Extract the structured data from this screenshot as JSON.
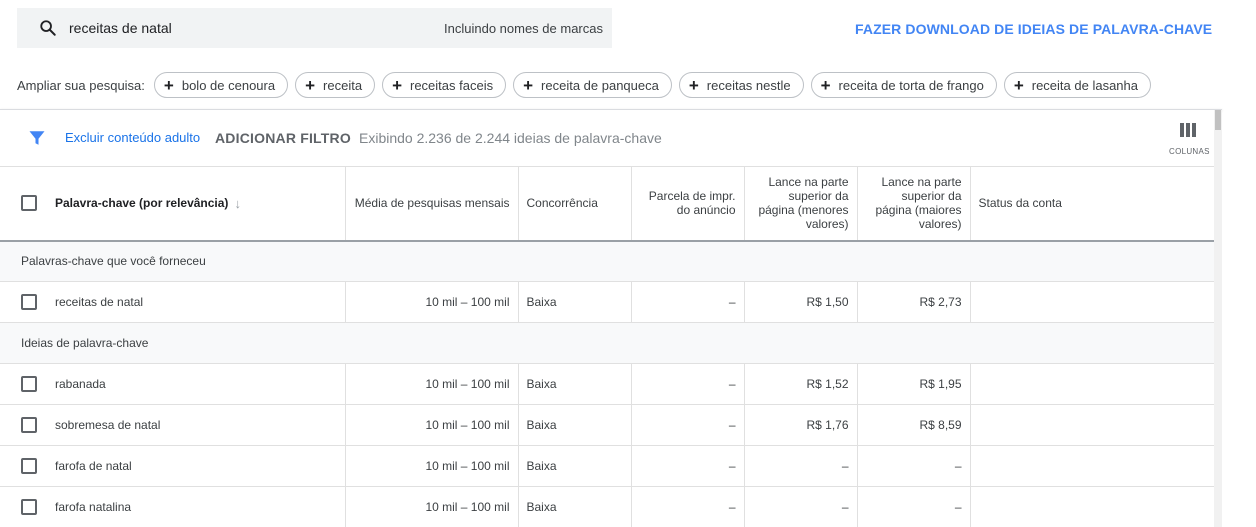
{
  "search": {
    "query": "receitas de natal",
    "brands_label": "Incluindo nomes de marcas",
    "download_label": "FAZER DOWNLOAD DE IDEIAS DE PALAVRA-CHAVE"
  },
  "broaden": {
    "label": "Ampliar sua pesquisa:",
    "chips": [
      "bolo de cenoura",
      "receita",
      "receitas faceis",
      "receita de panqueca",
      "receitas nestle",
      "receita de torta de frango",
      "receita de lasanha"
    ]
  },
  "filter_bar": {
    "adult_label": "Excluir conteúdo adulto",
    "add_filter_label": "ADICIONAR FILTRO",
    "showing_text": "Exibindo 2.236 de 2.244 ideias de palavra-chave",
    "columns_label": "COLUNAS"
  },
  "table": {
    "headers": {
      "keyword": "Palavra-chave (por relevância)",
      "searches": "Média de pesquisas mensais",
      "competition": "Concorrência",
      "impr_share": "Parcela de impr. do anúncio",
      "bid_low": "Lance na parte superior da página (menores valores)",
      "bid_high": "Lance na parte superior da página (maiores valores)",
      "status": "Status da conta"
    },
    "group_provided": "Palavras-chave que você forneceu",
    "group_ideas": "Ideias de palavra-chave",
    "provided_rows": [
      {
        "keyword": "receitas de natal",
        "searches": "10 mil – 100 mil",
        "competition": "Baixa",
        "impr_share": "–",
        "bid_low": "R$ 1,50",
        "bid_high": "R$ 2,73",
        "status": ""
      }
    ],
    "idea_rows": [
      {
        "keyword": "rabanada",
        "searches": "10 mil – 100 mil",
        "competition": "Baixa",
        "impr_share": "–",
        "bid_low": "R$ 1,52",
        "bid_high": "R$ 1,95",
        "status": ""
      },
      {
        "keyword": "sobremesa de natal",
        "searches": "10 mil – 100 mil",
        "competition": "Baixa",
        "impr_share": "–",
        "bid_low": "R$ 1,76",
        "bid_high": "R$ 8,59",
        "status": ""
      },
      {
        "keyword": "farofa de natal",
        "searches": "10 mil – 100 mil",
        "competition": "Baixa",
        "impr_share": "–",
        "bid_low": "–",
        "bid_high": "–",
        "status": ""
      },
      {
        "keyword": "farofa natalina",
        "searches": "10 mil – 100 mil",
        "competition": "Baixa",
        "impr_share": "–",
        "bid_low": "–",
        "bid_high": "–",
        "status": ""
      }
    ]
  },
  "colors": {
    "accent": "#4285f4",
    "link": "#1a73e8",
    "search_bg": "#f1f3f4",
    "group_bg": "#f8f9fa"
  },
  "icons": {
    "search": "search-icon",
    "filter": "filter-icon",
    "columns": "columns-icon",
    "sort": "arrow-down-icon",
    "add": "plus-icon"
  }
}
